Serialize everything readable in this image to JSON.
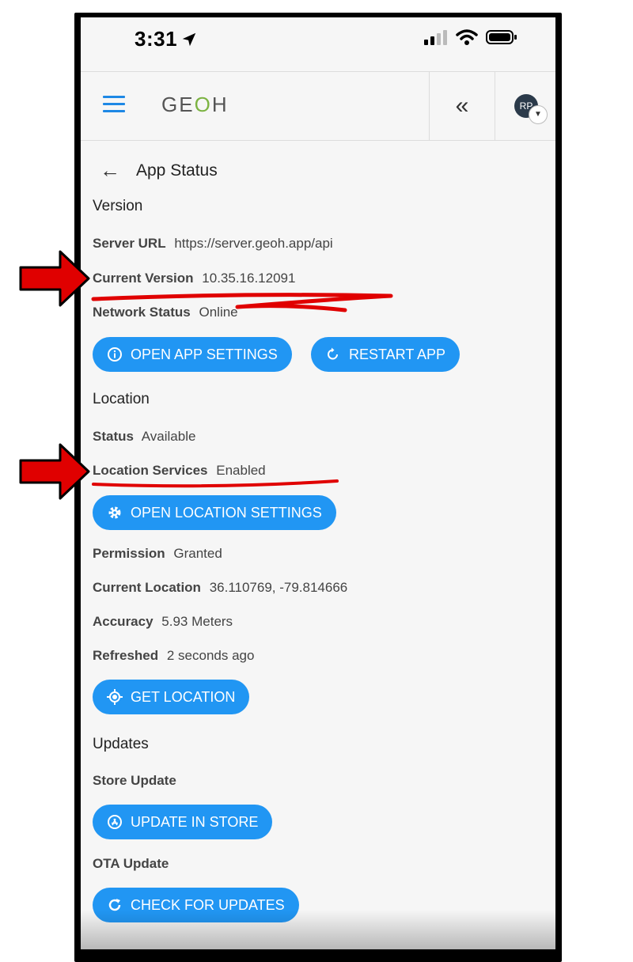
{
  "status_bar": {
    "time": "3:31"
  },
  "header": {
    "logo_text": "GE",
    "logo_o": "O",
    "logo_end": "H",
    "avatar_initials": "RP"
  },
  "page": {
    "title": "App Status"
  },
  "version": {
    "section_title": "Version",
    "server_url_label": "Server URL",
    "server_url_value": "https://server.geoh.app/api",
    "current_version_label": "Current Version",
    "current_version_value": "10.35.16.12091",
    "network_status_label": "Network Status",
    "network_status_value": "Online",
    "open_app_settings": "OPEN APP SETTINGS",
    "restart_app": "RESTART APP"
  },
  "location": {
    "section_title": "Location",
    "status_label": "Status",
    "status_value": "Available",
    "services_label": "Location Services",
    "services_value": "Enabled",
    "open_location_settings": "OPEN LOCATION SETTINGS",
    "permission_label": "Permission",
    "permission_value": "Granted",
    "current_location_label": "Current Location",
    "current_location_value": "36.110769, -79.814666",
    "accuracy_label": "Accuracy",
    "accuracy_value": "5.93 Meters",
    "refreshed_label": "Refreshed",
    "refreshed_value": "2 seconds ago",
    "get_location": "GET LOCATION"
  },
  "updates": {
    "section_title": "Updates",
    "store_update_label": "Store Update",
    "update_in_store": "UPDATE IN STORE",
    "ota_update_label": "OTA Update",
    "check_for_updates": "CHECK FOR UPDATES"
  },
  "colors": {
    "accent": "#2196f3",
    "annotation": "#e00000",
    "logo_check": "#7cb342"
  }
}
